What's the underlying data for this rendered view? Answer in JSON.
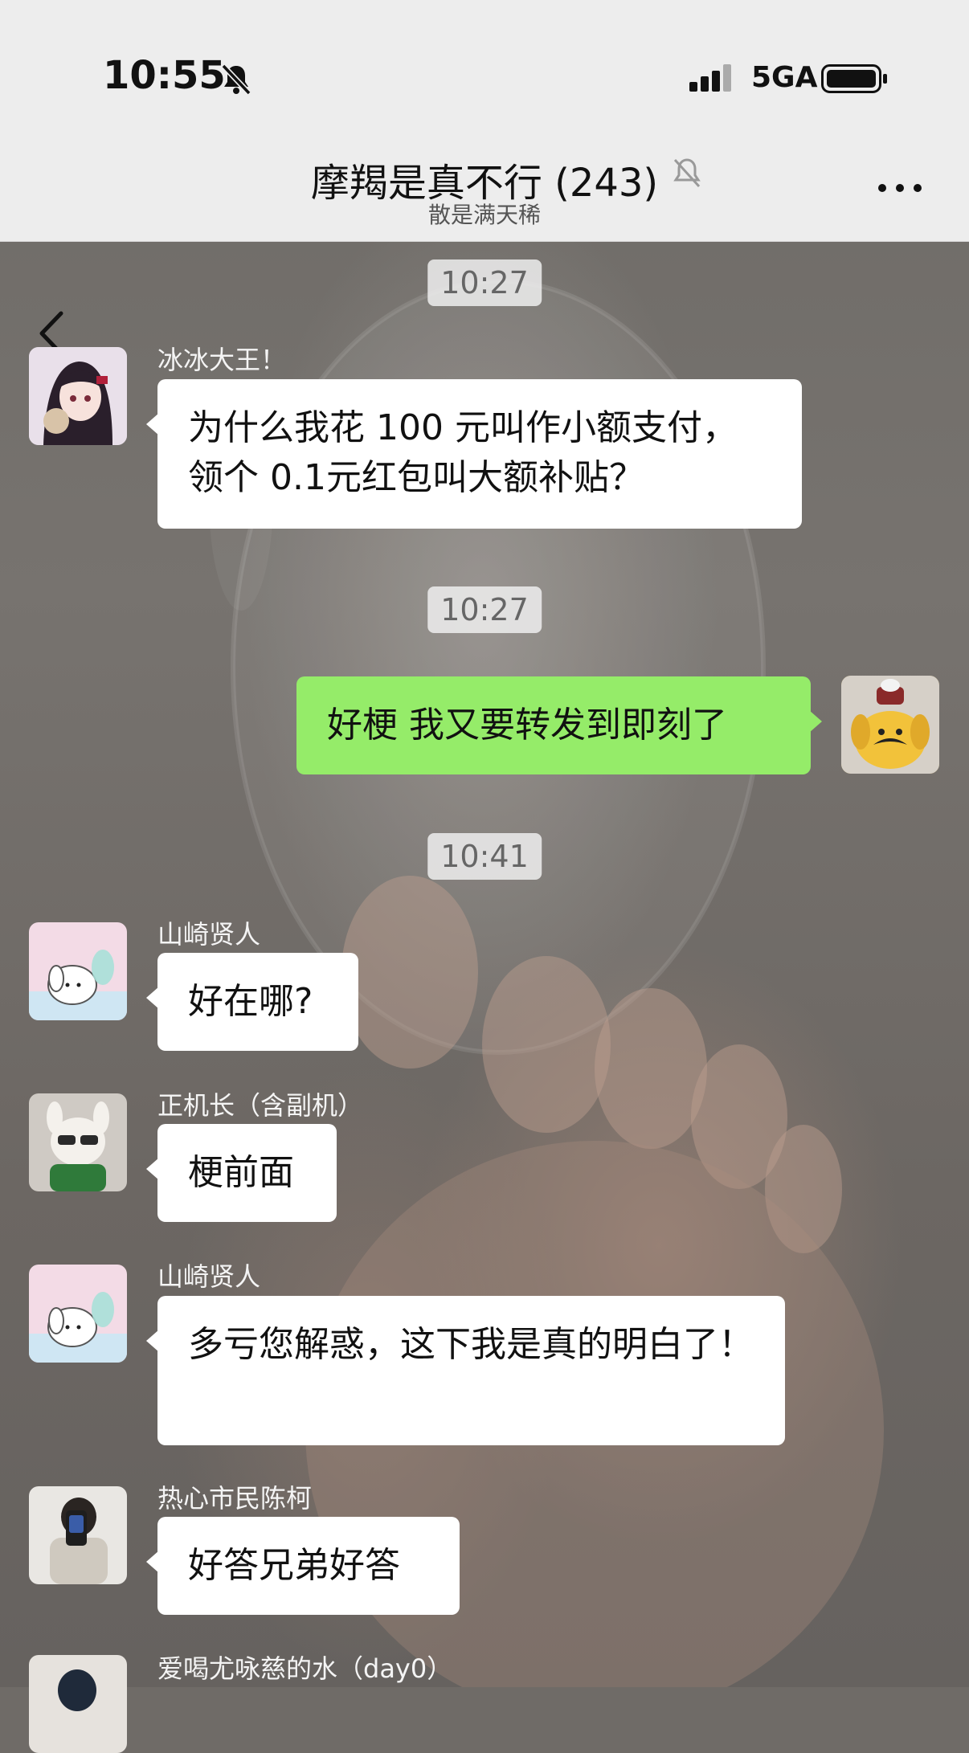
{
  "status_bar": {
    "time": "10:55",
    "network": "5GA"
  },
  "header": {
    "title": "摩羯是真不行 (243)",
    "subtitle": "散是满天稀"
  },
  "messages": [
    {
      "type": "time",
      "text": "10:27"
    },
    {
      "type": "in",
      "sender": "冰冰大王！",
      "text": "为什么我花 100 元叫作小额支付，领个 0.1元红包叫大额补贴？",
      "avatar": "anime-girl-avatar"
    },
    {
      "type": "time",
      "text": "10:27"
    },
    {
      "type": "out",
      "text": "好梗 我又要转发到即刻了",
      "avatar": "yellow-plush-avatar"
    },
    {
      "type": "time",
      "text": "10:41"
    },
    {
      "type": "in",
      "sender": "山崎贤人",
      "text": "好在哪?",
      "avatar": "pochacco-avatar"
    },
    {
      "type": "in",
      "sender": "正机长（含副机）",
      "text": "梗前面",
      "avatar": "dog-plush-avatar"
    },
    {
      "type": "in",
      "sender": "山崎贤人",
      "text": "多亏您解惑，这下我是真的明白了！",
      "avatar": "pochacco-avatar"
    },
    {
      "type": "in",
      "sender": "热心市民陈柯",
      "text": "好答兄弟好答",
      "avatar": "selfie-avatar"
    },
    {
      "type": "in",
      "sender": "爱喝尤咏慈的水（day0）",
      "text": "",
      "avatar": "person-avatar"
    }
  ],
  "colors": {
    "bar_background": "#ededed",
    "outgoing_bubble": "#95ec69",
    "incoming_bubble": "#ffffff"
  }
}
